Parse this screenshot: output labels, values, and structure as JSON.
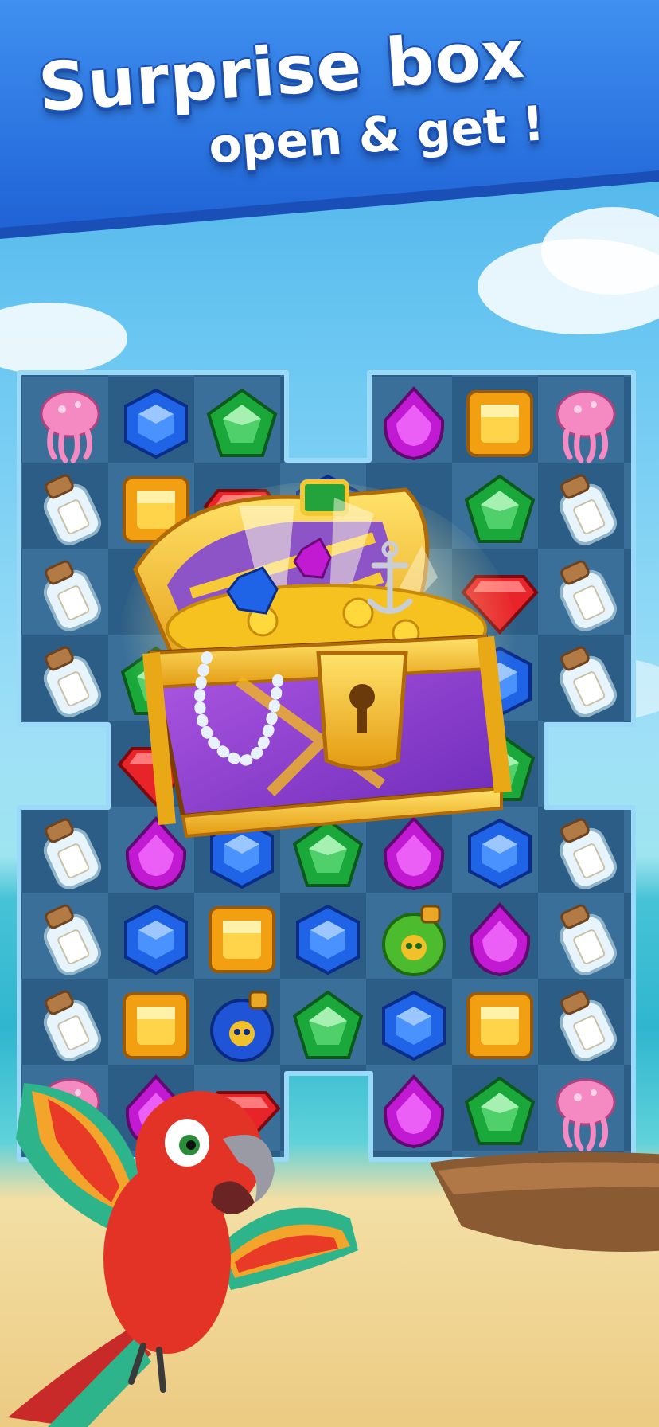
{
  "banner": {
    "line1": "Surprise box",
    "line2": "open & get !"
  },
  "colors": {
    "banner": "#2f78e0",
    "board": "#2f5f88",
    "board_border": "#8fd2f5",
    "blue_gem": "#1f63e6",
    "green_gem": "#1aa83a",
    "purple_gem": "#c21ad3",
    "orange_gem": "#f2a012",
    "red_gem": "#e8242a"
  },
  "board": {
    "rows": [
      [
        "jellyfish",
        "blue-hex",
        "green-pentagon",
        "none",
        "purple-drop",
        "orange-square",
        "jellyfish"
      ],
      [
        "bottle",
        "orange-square",
        "red-diamond",
        "blue-hex",
        "none",
        "green-pentagon",
        "bottle"
      ],
      [
        "bottle",
        "none",
        "none",
        "none",
        "none",
        "red-diamond",
        "bottle"
      ],
      [
        "bottle",
        "green-pentagon",
        "none",
        "none",
        "none",
        "blue-hex",
        "bottle"
      ],
      [
        "none",
        "red-diamond",
        "none",
        "none",
        "none",
        "green-pentagon",
        "none"
      ],
      [
        "bottle",
        "purple-drop",
        "blue-hex",
        "green-pentagon",
        "purple-drop",
        "blue-hex",
        "bottle"
      ],
      [
        "bottle",
        "blue-hex",
        "orange-square",
        "blue-hex",
        "green-bomb",
        "purple-drop",
        "bottle"
      ],
      [
        "bottle",
        "orange-square",
        "blue-bomb",
        "green-pentagon",
        "blue-hex",
        "orange-square",
        "bottle"
      ],
      [
        "jellyfish",
        "purple-drop",
        "red-diamond",
        "none",
        "purple-drop",
        "green-pentagon",
        "jellyfish"
      ]
    ]
  },
  "overlays": [
    "treasure-chest",
    "parrot",
    "boat"
  ]
}
